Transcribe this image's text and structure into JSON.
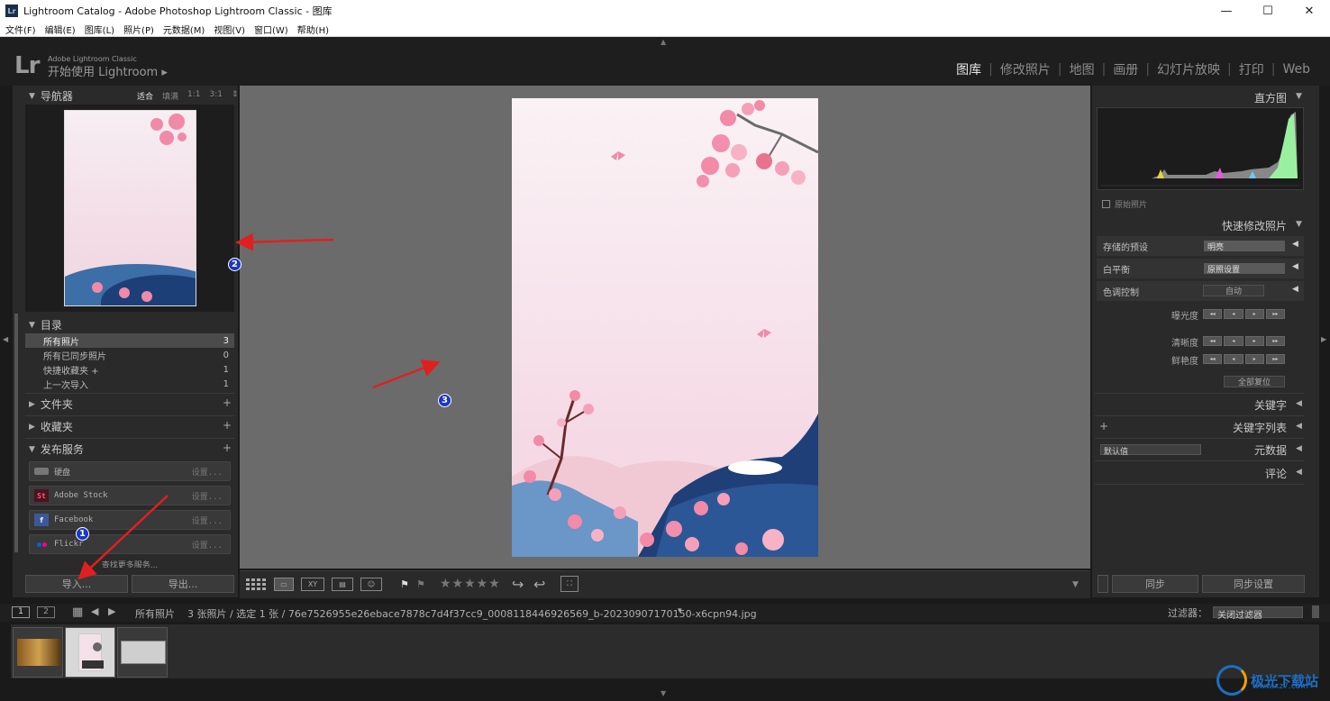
{
  "window": {
    "title": "Lightroom Catalog - Adobe Photoshop Lightroom Classic - 图库",
    "app_icon": "Lr",
    "controls": [
      "—",
      "☐",
      "✕"
    ]
  },
  "menu": [
    "文件(F)",
    "编辑(E)",
    "图库(L)",
    "照片(P)",
    "元数据(M)",
    "视图(V)",
    "窗口(W)",
    "帮助(H)"
  ],
  "header": {
    "logo": "Lr",
    "product": "Adobe Lightroom Classic",
    "start": "开始使用 Lightroom",
    "start_arrow": "▸",
    "modules": [
      "图库",
      "修改照片",
      "地图",
      "画册",
      "幻灯片放映",
      "打印",
      "Web"
    ],
    "active_module": "图库"
  },
  "navigator": {
    "title": "导航器",
    "options": [
      "适合",
      "填满",
      "1:1",
      "3:1"
    ],
    "selected_option": "适合",
    "menu_arrow": "⇕"
  },
  "catalog": {
    "title": "目录",
    "rows": [
      {
        "label": "所有照片",
        "count": "3"
      },
      {
        "label": "所有已同步照片",
        "count": "0"
      },
      {
        "label": "快捷收藏夹 +",
        "count": "1"
      },
      {
        "label": "上一次导入",
        "count": "1"
      }
    ]
  },
  "folders": {
    "title": "文件夹"
  },
  "collections": {
    "title": "收藏夹"
  },
  "publish": {
    "title": "发布服务",
    "items": [
      {
        "label": "硬盘",
        "icon": "hdd-icon",
        "setting": "设置..."
      },
      {
        "label": "Adobe Stock",
        "icon": "adobe-stock-icon",
        "setting": "设置..."
      },
      {
        "label": "Facebook",
        "icon": "facebook-icon",
        "setting": "设置..."
      },
      {
        "label": "Flickr",
        "icon": "flickr-icon",
        "setting": "设置..."
      }
    ],
    "more": "查找更多服务..."
  },
  "buttons": {
    "import": "导入...",
    "export": "导出...",
    "sync": "同步",
    "sync_settings": "同步设置"
  },
  "histogram": {
    "title": "直方图",
    "original": "原始照片"
  },
  "quick_develop": {
    "title": "快速修改照片",
    "saved_preset_label": "存储的预设",
    "saved_preset_value": "明亮",
    "wb_label": "白平衡",
    "wb_value": "原照设置",
    "tone_label": "色调控制",
    "auto": "自动",
    "exposure": "曝光度",
    "clarity": "清晰度",
    "vibrance": "鲜艳度",
    "reset": "全部复位"
  },
  "right_sections": {
    "keywording": "关键字",
    "keyword_list": "关键字列表",
    "metadata": "元数据",
    "metadata_preset": "默认值",
    "comments": "评论"
  },
  "toolbar": {
    "stars": "★★★★★"
  },
  "filmstrip": {
    "page1": "1",
    "page2": "2",
    "source": "所有照片",
    "info": "3 张照片 / 选定 1 张 / 76e7526955e26ebace7878c7d4f37cc9_0008118446926569_b-20230907170150-x6cpn94.jpg",
    "source_arrow": "▾",
    "filter_label": "过滤器：",
    "filter_value": "关闭过滤器"
  },
  "annotations": {
    "m1": "1",
    "m2": "2",
    "m3": "3"
  },
  "watermark": {
    "text": "极光下载站",
    "url": "www.xz7.com"
  },
  "colors": {
    "accent_red": "#e02020",
    "marker_blue": "#1a36c8"
  }
}
